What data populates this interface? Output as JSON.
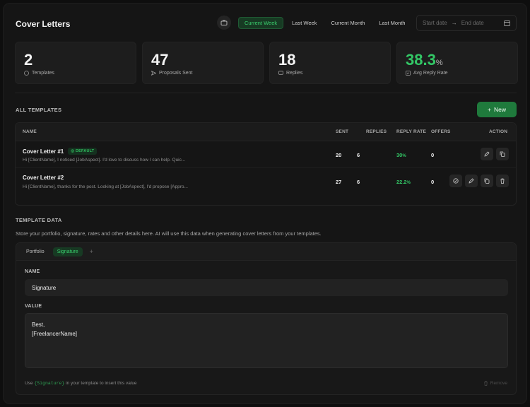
{
  "header": {
    "title": "Cover Letters",
    "ranges": [
      "Current Week",
      "Last Week",
      "Current Month",
      "Last Month"
    ],
    "active_range": "Current Week",
    "start_placeholder": "Start date",
    "end_placeholder": "End date"
  },
  "stats": [
    {
      "value": "2",
      "label": "Templates",
      "icon": "document-icon"
    },
    {
      "value": "47",
      "label": "Proposals Sent",
      "icon": "send-icon"
    },
    {
      "value": "18",
      "label": "Replies",
      "icon": "chat-icon"
    },
    {
      "value": "38.3",
      "unit": "%",
      "label": "Avg Reply Rate",
      "icon": "chart-icon"
    }
  ],
  "templates": {
    "section_title": "ALL TEMPLATES",
    "new_label": "New",
    "columns": {
      "name": "NAME",
      "sent": "SENT",
      "replies": "REPLIES",
      "reply_rate": "REPLY RATE",
      "offers": "OFFERS",
      "action": "ACTION"
    },
    "rows": [
      {
        "name": "Cover Letter #1",
        "badge": "DEFAULT",
        "preview": "Hi [ClientName], I noticed [JobAspect]. I'd love to discuss how I can help. Quic...",
        "sent": "20",
        "replies": "6",
        "rate": "30",
        "rate_unit": "%",
        "offers": "0"
      },
      {
        "name": "Cover Letter #2",
        "badge": "",
        "preview": "Hi [ClientName], thanks for the post. Looking at [JobAspect], I'd propose [Appro...",
        "sent": "27",
        "replies": "6",
        "rate": "22.2",
        "rate_unit": "%",
        "offers": "0"
      }
    ]
  },
  "template_data": {
    "section_title": "TEMPLATE DATA",
    "description": "Store your portfolio, signature, rates and other details here. AI will use this data when generating cover letters from your templates.",
    "tabs": [
      "Portfolio",
      "Signature"
    ],
    "active_tab": "Signature",
    "add_tab": "+",
    "name_label": "NAME",
    "name_value": "Signature",
    "value_label": "VALUE",
    "value_line1": "Best,",
    "value_line2": "[FreelancerName]",
    "hint_prefix": "Use",
    "hint_token": "{Signature}",
    "hint_suffix": "in your template to insert this value",
    "remove_label": "Remove"
  },
  "colors": {
    "accent": "#33c766",
    "accent_bg": "#173a23",
    "button": "#1f7a3c",
    "background": "#151515"
  }
}
